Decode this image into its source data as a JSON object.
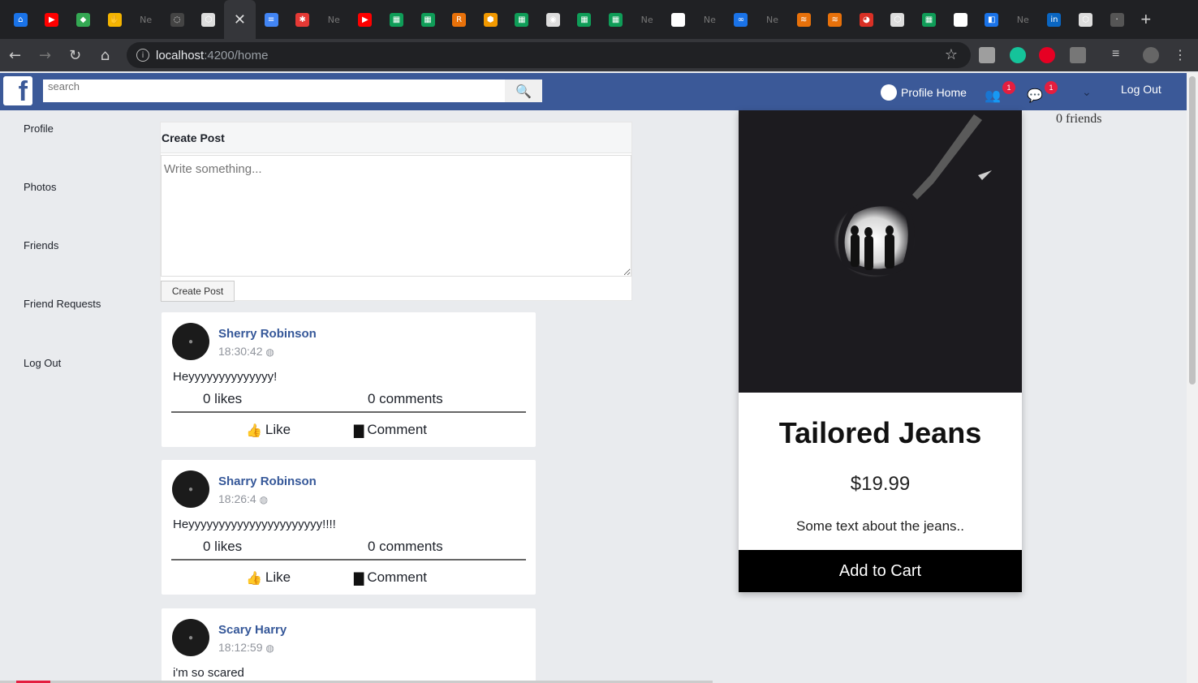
{
  "browser": {
    "tabs": [
      {
        "icon": "home-app-icon",
        "color": "#1a73e8",
        "glyph": "⌂"
      },
      {
        "icon": "youtube-icon",
        "color": "#ff0000",
        "glyph": "▶"
      },
      {
        "icon": "green-diamond-icon",
        "color": "#34a853",
        "glyph": "◆"
      },
      {
        "icon": "hand-icon",
        "color": "#f4b400",
        "glyph": "✋"
      },
      {
        "icon": "ne-label",
        "color": "",
        "glyph": "Ne"
      },
      {
        "icon": "circle-icon",
        "color": "#444",
        "glyph": "◌"
      },
      {
        "icon": "codepen-icon",
        "color": "#dddddd",
        "glyph": "⬡"
      },
      {
        "icon": "close-tab-icon",
        "color": "",
        "glyph": "✕",
        "active": true
      },
      {
        "icon": "docs-icon",
        "color": "#4285f4",
        "glyph": "≡"
      },
      {
        "icon": "red-app-icon",
        "color": "#e53935",
        "glyph": "✱"
      },
      {
        "icon": "ne-label",
        "color": "",
        "glyph": "Ne"
      },
      {
        "icon": "youtube-icon",
        "color": "#ff0000",
        "glyph": "▶"
      },
      {
        "icon": "sheets-icon",
        "color": "#0f9d58",
        "glyph": "▦"
      },
      {
        "icon": "sheets-icon",
        "color": "#0f9d58",
        "glyph": "▦"
      },
      {
        "icon": "r-icon",
        "color": "#e8710a",
        "glyph": "R"
      },
      {
        "icon": "shield-icon",
        "color": "#f29900",
        "glyph": "⬢"
      },
      {
        "icon": "sheets-icon",
        "color": "#0f9d58",
        "glyph": "▦"
      },
      {
        "icon": "chrome-icon",
        "color": "#dddddd",
        "glyph": "◉"
      },
      {
        "icon": "sheets-icon",
        "color": "#0f9d58",
        "glyph": "▦"
      },
      {
        "icon": "sheets-icon",
        "color": "#0f9d58",
        "glyph": "▦"
      },
      {
        "icon": "ne-label",
        "color": "",
        "glyph": "Ne"
      },
      {
        "icon": "github-icon",
        "color": "#ffffff",
        "glyph": "●"
      },
      {
        "icon": "ne-label",
        "color": "",
        "glyph": "Ne"
      },
      {
        "icon": "infinity-icon",
        "color": "#1a73e8",
        "glyph": "∞"
      },
      {
        "icon": "ne-label",
        "color": "",
        "glyph": "Ne"
      },
      {
        "icon": "layers-icon",
        "color": "#e8710a",
        "glyph": "≋"
      },
      {
        "icon": "layers-icon",
        "color": "#e8710a",
        "glyph": "≋"
      },
      {
        "icon": "firefox-icon",
        "color": "#d93025",
        "glyph": "◕"
      },
      {
        "icon": "codepen-icon",
        "color": "#dddddd",
        "glyph": "⬡"
      },
      {
        "icon": "sheets-icon",
        "color": "#0f9d58",
        "glyph": "▦"
      },
      {
        "icon": "github-icon",
        "color": "#ffffff",
        "glyph": "●"
      },
      {
        "icon": "vscode-icon",
        "color": "#1a73e8",
        "glyph": "◧"
      },
      {
        "icon": "ne-label",
        "color": "",
        "glyph": "Ne"
      },
      {
        "icon": "linkedin-icon",
        "color": "#0a66c2",
        "glyph": "in"
      },
      {
        "icon": "codepen-icon",
        "color": "#dddddd",
        "glyph": "⬡"
      },
      {
        "icon": "small-icon",
        "color": "#555",
        "glyph": "·"
      }
    ],
    "new_tab_glyph": "+",
    "url_host": "localhost",
    "url_rest": ":4200/home"
  },
  "navbar": {
    "logo": "f",
    "search_placeholder": "search",
    "profile_link": "Profile Home",
    "friend_requests_badge": "1",
    "messages_badge": "1",
    "logout": "Log Out"
  },
  "sidebar": {
    "items": [
      "Profile",
      "Photos",
      "Friends",
      "Friend Requests",
      "Log Out"
    ]
  },
  "create_post": {
    "heading": "Create Post",
    "placeholder": "Write something...",
    "button": "Create Post"
  },
  "posts": [
    {
      "author": "Sherry Robinson",
      "time": "18:30:42",
      "text": "Heyyyyyyyyyyyyyy!",
      "likes": "0 likes",
      "comments": "0 comments",
      "like_label": "Like",
      "comment_label": "Comment"
    },
    {
      "author": "Sharry Robinson",
      "time": "18:26:4",
      "text": "Heyyyyyyyyyyyyyyyyyyyyyy!!!!",
      "likes": "0 likes",
      "comments": "0 comments",
      "like_label": "Like",
      "comment_label": "Comment"
    },
    {
      "author": "Scary Harry",
      "time": "18:12:59",
      "text": "i'm so scared",
      "likes": "",
      "comments": "",
      "like_label": "",
      "comment_label": ""
    }
  ],
  "product": {
    "title": "Tailored Jeans",
    "price": "$19.99",
    "description": "Some text about the jeans..",
    "button": "Add to Cart"
  },
  "friends_count": "0 friends",
  "colors": {
    "fb_blue": "#3b5998",
    "link_blue": "#365899",
    "badge_red": "#e41e3f"
  }
}
